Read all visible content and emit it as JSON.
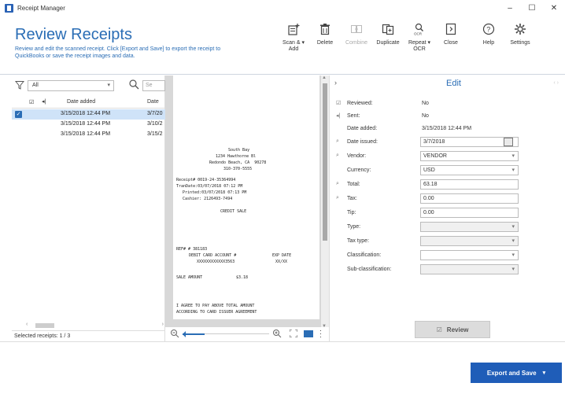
{
  "window": {
    "title": "Receipt Manager",
    "controls": {
      "minimize": "–",
      "maximize": "☐",
      "close": "✕"
    }
  },
  "ribbon": {
    "title": "Review Receipts",
    "description": "Review and edit the scanned receipt. Click [Export and Save] to export the receipt to QuickBooks or save the receipt images and data.",
    "tools": [
      {
        "id": "scan-add",
        "label": "Scan & ▾\nAdd",
        "icon": "scan-add-icon",
        "enabled": true
      },
      {
        "id": "delete",
        "label": "Delete",
        "icon": "trash-icon",
        "enabled": true
      },
      {
        "id": "combine",
        "label": "Combine",
        "icon": "combine-icon",
        "enabled": false
      },
      {
        "id": "duplicate",
        "label": "Duplicate",
        "icon": "duplicate-icon",
        "enabled": true
      },
      {
        "id": "repeat-ocr",
        "label": "Repeat ▾\nOCR",
        "icon": "ocr-icon",
        "enabled": true
      },
      {
        "id": "close",
        "label": "Close",
        "icon": "close-doc-icon",
        "enabled": true
      },
      {
        "id": "help",
        "label": "Help",
        "icon": "help-icon",
        "enabled": true
      },
      {
        "id": "settings",
        "label": "Settings",
        "icon": "gear-icon",
        "enabled": true
      }
    ]
  },
  "list": {
    "filter_value": "All",
    "search_placeholder": "Se",
    "columns": {
      "reviewed": "☑",
      "sent": "◂|",
      "date_added": "Date added",
      "date_issued": "Date"
    },
    "rows": [
      {
        "checked": true,
        "date_added": "3/15/2018 12:44 PM",
        "date_issued": "3/7/20",
        "selected": true
      },
      {
        "checked": false,
        "date_added": "3/15/2018 12:44 PM",
        "date_issued": "3/10/2",
        "selected": false
      },
      {
        "checked": false,
        "date_added": "3/15/2018 12:44 PM",
        "date_issued": "3/15/2",
        "selected": false
      }
    ],
    "footer": "Selected receipts: 1 / 3"
  },
  "receipt_text": {
    "store": "South Bay",
    "addr1": "1234 Hawthorne Bl",
    "addr2": "Redondo Beach, CA  90278",
    "phone": "310-370-5555",
    "receipt_no": "Receipt# 0019-24-35364994",
    "tran_date": "TranDate:03/07/2018 07:12 PM",
    "printed": "Printed:03/07/2018 07:13 PM",
    "cashier": "Cashier: 2126493-7494",
    "sale_type": "CREDIT SALE",
    "ref": "REF# # 381183",
    "card": "DEBIT CARD ACCOUNT #",
    "exp": "EXP DATE",
    "card_no": "XXXXXXXXXXXX3563",
    "exp_val": "XX/XX",
    "sale_amount_label": "SALE AMOUNT",
    "sale_amount": "$3.18",
    "agree1": "I AGREE TO PAY ABOVE TOTAL AMOUNT",
    "agree2": "ACCORDING TO CARD ISSUER AGREEMENT"
  },
  "edit": {
    "title": "Edit",
    "fields": [
      {
        "label": "Reviewed:",
        "value": "No",
        "type": "text",
        "icon": "reviewed-icon"
      },
      {
        "label": "Sent:",
        "value": "No",
        "type": "text",
        "icon": "sent-icon"
      },
      {
        "label": "Date added:",
        "value": "3/15/2018 12:44 PM",
        "type": "text",
        "icon": ""
      },
      {
        "label": "Date issued:",
        "value": "3/7/2018",
        "type": "date",
        "icon": "ocr-field-icon"
      },
      {
        "label": "Vendor:",
        "value": "VENDOR",
        "type": "select",
        "icon": "ocr-field-icon"
      },
      {
        "label": "Currency:",
        "value": "USD",
        "type": "select",
        "icon": ""
      },
      {
        "label": "Total:",
        "value": "63.18",
        "type": "input",
        "icon": "ocr-field-icon"
      },
      {
        "label": "Tax:",
        "value": "0.00",
        "type": "input",
        "icon": "ocr-field-icon"
      },
      {
        "label": "Tip:",
        "value": "0.00",
        "type": "input",
        "icon": ""
      },
      {
        "label": "Type:",
        "value": "",
        "type": "select-disabled",
        "icon": ""
      },
      {
        "label": "Tax type:",
        "value": "",
        "type": "select-disabled",
        "icon": ""
      },
      {
        "label": "Classification:",
        "value": "",
        "type": "select",
        "icon": ""
      },
      {
        "label": "Sub-classification:",
        "value": "",
        "type": "select-disabled",
        "icon": ""
      }
    ],
    "review_button": "Review"
  },
  "footer": {
    "export_button": "Export and Save"
  }
}
